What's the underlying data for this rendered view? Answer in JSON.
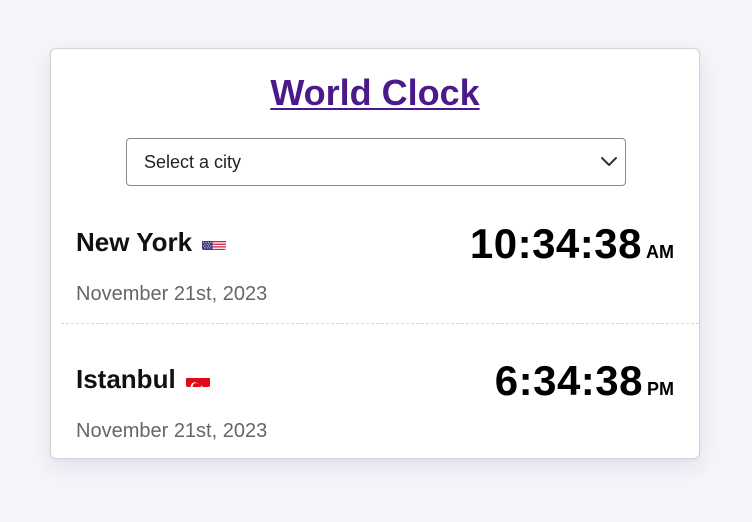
{
  "header": {
    "title": "World Clock"
  },
  "city_select": {
    "placeholder": "Select a city",
    "icon": "chevron-down-icon"
  },
  "cities": [
    {
      "name": "New York",
      "flag": "us-flag-icon",
      "time": "10:34:38",
      "period": "AM",
      "date": "November 21st, 2023"
    },
    {
      "name": "Istanbul",
      "flag": "turkey-flag-icon",
      "time": "6:34:38",
      "period": "PM",
      "date": "November 21st, 2023"
    }
  ],
  "colors": {
    "title": "#4a1a8a",
    "background": "#f7f5fb",
    "card": "#ffffff",
    "date_text": "#666666"
  }
}
